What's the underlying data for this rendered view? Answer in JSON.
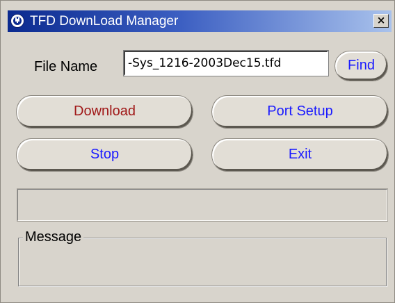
{
  "window": {
    "title": "TFD DownLoad Manager",
    "close_glyph": "×",
    "icon": "app-logo-icon"
  },
  "file": {
    "label": "File Name",
    "value": "-Sys_1216-2003Dec15.tfd"
  },
  "buttons": {
    "find": "Find",
    "download": "Download",
    "port_setup": "Port Setup",
    "stop": "Stop",
    "exit": "Exit"
  },
  "message": {
    "label": "Message"
  },
  "colors": {
    "download_text": "#a01818",
    "blue_text": "#1a1aff",
    "title_bar": "#0b2a8f"
  }
}
